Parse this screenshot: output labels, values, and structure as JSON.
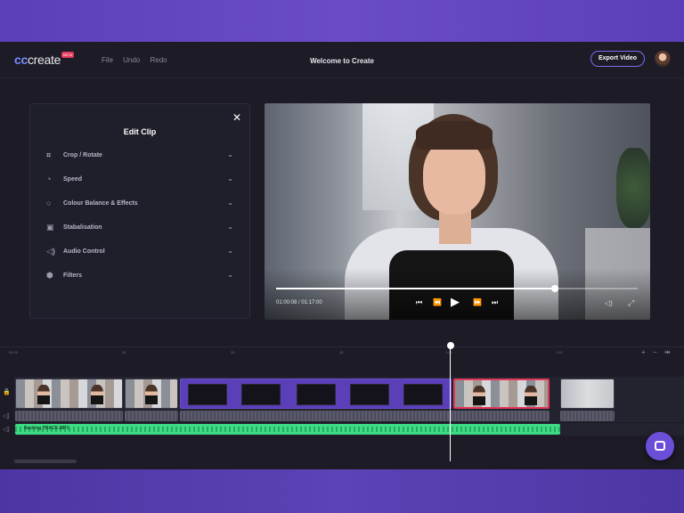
{
  "header": {
    "logo_cc": "cc",
    "logo_create": "create",
    "beta_badge": "BETA",
    "menu": [
      "File",
      "Undo",
      "Redo"
    ],
    "title": "Welcome to Create",
    "export_label": "Export Video"
  },
  "edit_clip": {
    "title": "Edit Clip",
    "items": [
      {
        "label": "Crop / Rotate",
        "icon": "crop-icon"
      },
      {
        "label": "Speed",
        "icon": "speed-icon"
      },
      {
        "label": "Colour Balance & Effects",
        "icon": "colour-icon"
      },
      {
        "label": "Stabalisation",
        "icon": "stabilisation-icon"
      },
      {
        "label": "Audio Control",
        "icon": "audio-icon"
      },
      {
        "label": "Filters",
        "icon": "filters-icon"
      }
    ]
  },
  "player": {
    "timecode": "01:00:08 / 01:17:00",
    "progress": 0.77
  },
  "timeline": {
    "ruler": [
      "00:00",
      "15",
      "30",
      "45",
      "1:00",
      "1:15"
    ],
    "music_label": "Backing TRACK.MP3"
  },
  "colors": {
    "accent": "#7b6ef0",
    "selected": "#e23a5a",
    "music": "#3ddc84"
  }
}
